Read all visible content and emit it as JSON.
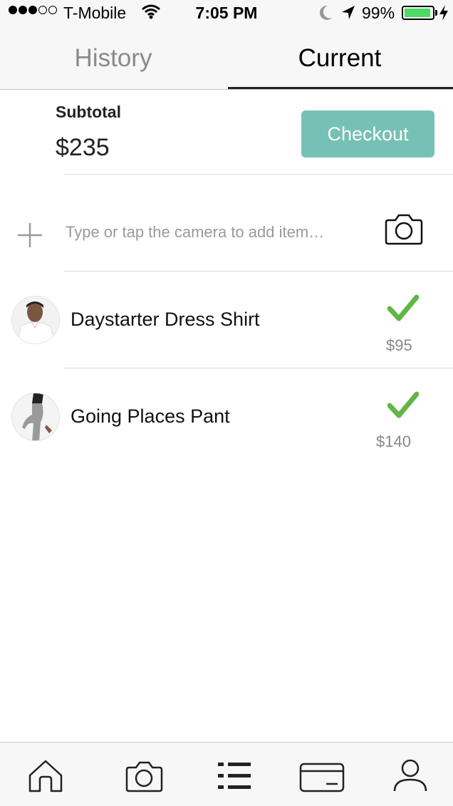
{
  "status_bar": {
    "carrier": "T-Mobile",
    "time": "7:05 PM",
    "battery_percent": "99%",
    "signal_bars_filled": 3,
    "signal_bars_total": 5,
    "icons": [
      "wifi-icon",
      "moon-icon",
      "location-arrow-icon",
      "battery-icon",
      "charging-bolt-icon"
    ]
  },
  "tabs": [
    {
      "label": "History",
      "active": false
    },
    {
      "label": "Current",
      "active": true
    }
  ],
  "summary": {
    "subtotal_label": "Subtotal",
    "subtotal_value": "$235",
    "checkout_label": "Checkout",
    "checkout_color": "#77c0b5"
  },
  "add_item": {
    "placeholder": "Type or tap the camera to add item…",
    "icons": [
      "plus-icon",
      "camera-icon"
    ]
  },
  "items": [
    {
      "name": "Daystarter Dress Shirt",
      "price": "$95",
      "checked": true,
      "thumbnail": "shirt-photo"
    },
    {
      "name": "Going Places Pant",
      "price": "$140",
      "checked": true,
      "thumbnail": "pant-photo"
    }
  ],
  "colors": {
    "check": "#62b647",
    "accent": "#77c0b5",
    "battery": "#4cd964"
  },
  "bottom_nav": [
    {
      "icon": "home-icon"
    },
    {
      "icon": "camera-icon"
    },
    {
      "icon": "list-icon"
    },
    {
      "icon": "card-icon"
    },
    {
      "icon": "profile-icon"
    }
  ]
}
